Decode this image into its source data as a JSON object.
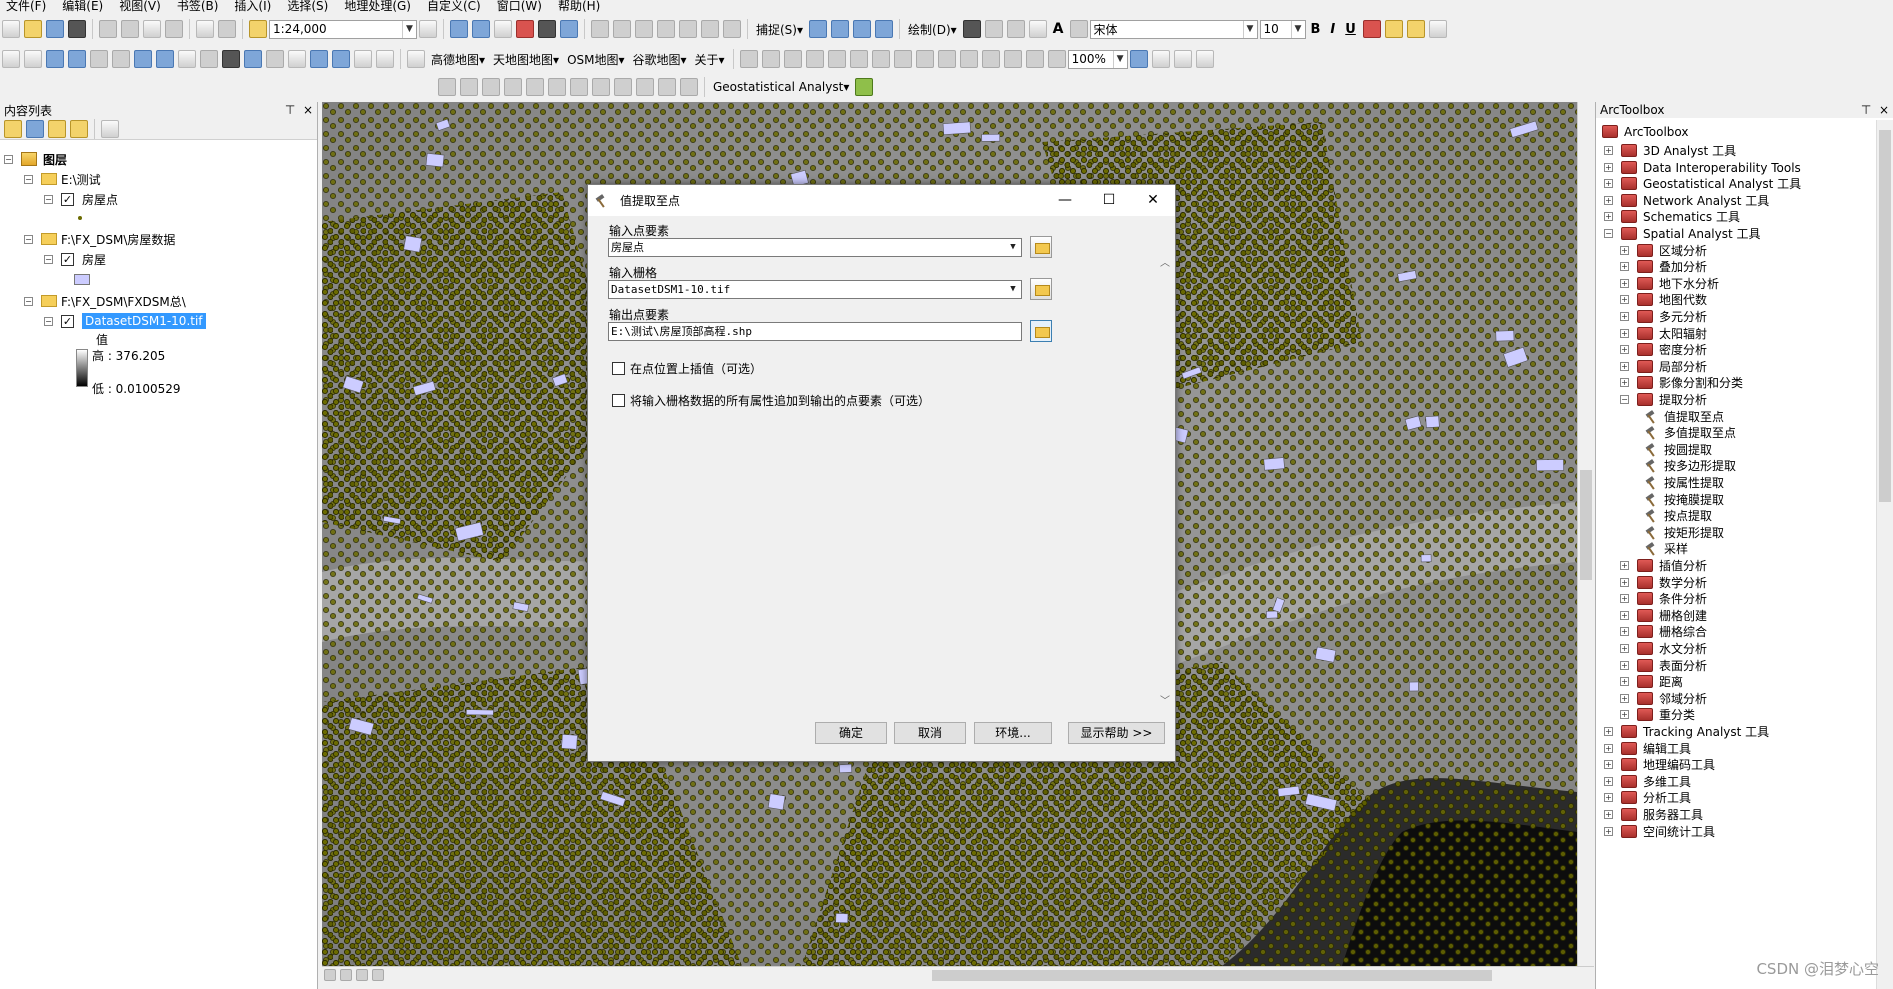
{
  "menu": [
    "文件(F)",
    "编辑(E)",
    "视图(V)",
    "书签(B)",
    "插入(I)",
    "选择(S)",
    "地理处理(G)",
    "自定义(C)",
    "窗口(W)",
    "帮助(H)"
  ],
  "toolbar1": {
    "scale": "1:24,000",
    "snap_label": "捕捉(S)▾",
    "draw_label": "绘制(D)▾",
    "font_name": "宋体",
    "font_size": "10",
    "bold": "B",
    "italic": "I",
    "underline": "U",
    "text_a": "A"
  },
  "toolbar2": {
    "basemaps": [
      "高德地图▾",
      "天地图地图▾",
      "OSM地图▾",
      "谷歌地图▾",
      "关于▾"
    ],
    "zoom": "100%"
  },
  "toolbar3": {
    "geostat_label": "Geostatistical Analyst▾"
  },
  "left_panel": {
    "title": "内容列表",
    "pin": "⊤",
    "close": "×",
    "root": "图层",
    "group1": "E:\\测试",
    "layer1": "房屋点",
    "group2": "F:\\FX_DSM\\房屋数据",
    "layer2": "房屋",
    "group3": "F:\\FX_DSM\\FXDSM总\\",
    "layer3": "DatasetDSM1-10.tif",
    "legend_title": "值",
    "high": "高 : 376.205",
    "low": "低 : 0.0100529"
  },
  "right_panel": {
    "title": "ArcToolbox",
    "pin": "⊤",
    "close": "×",
    "root": "ArcToolbox",
    "toolsets_top": [
      "3D Analyst 工具",
      "Data Interoperability Tools",
      "Geostatistical Analyst 工具",
      "Network Analyst 工具",
      "Schematics 工具",
      "Spatial Analyst 工具"
    ],
    "spatial_children": [
      "区域分析",
      "叠加分析",
      "地下水分析",
      "地图代数",
      "多元分析",
      "太阳辐射",
      "密度分析",
      "局部分析",
      "影像分割和分类",
      "提取分析"
    ],
    "extract_tools": [
      "值提取至点",
      "多值提取至点",
      "按圆提取",
      "按多边形提取",
      "按属性提取",
      "按掩膜提取",
      "按点提取",
      "按矩形提取",
      "采样"
    ],
    "spatial_children2": [
      "插值分析",
      "数学分析",
      "条件分析",
      "栅格创建",
      "栅格综合",
      "水文分析",
      "表面分析",
      "距离",
      "邻域分析",
      "重分类"
    ],
    "toolsets_bottom": [
      "Tracking Analyst 工具",
      "编辑工具",
      "地理编码工具",
      "多维工具",
      "分析工具",
      "服务器工具",
      "空间统计工具"
    ]
  },
  "dialog": {
    "title": "值提取至点",
    "min": "—",
    "max": "☐",
    "close": "✕",
    "label_points": "输入点要素",
    "value_points": "房屋点",
    "label_raster": "输入栅格",
    "value_raster": "DatasetDSM1-10.tif",
    "label_output": "输出点要素",
    "value_output": "E:\\测试\\房屋顶部高程.shp",
    "chk_interp": "在点位置上插值（可选）",
    "chk_append": "将输入栅格数据的所有属性追加到输出的点要素（可选）",
    "btn_ok": "确定",
    "btn_cancel": "取消",
    "btn_env": "环境...",
    "btn_help": "显示帮助 >>"
  },
  "watermark": "CSDN @泪梦心空",
  "colors": {
    "point_fill": "#6b6b00",
    "point_stroke": "#2f2f00",
    "selection": "#3399ff",
    "toolbox_red": "#c0392b",
    "building": "#ccccff"
  }
}
